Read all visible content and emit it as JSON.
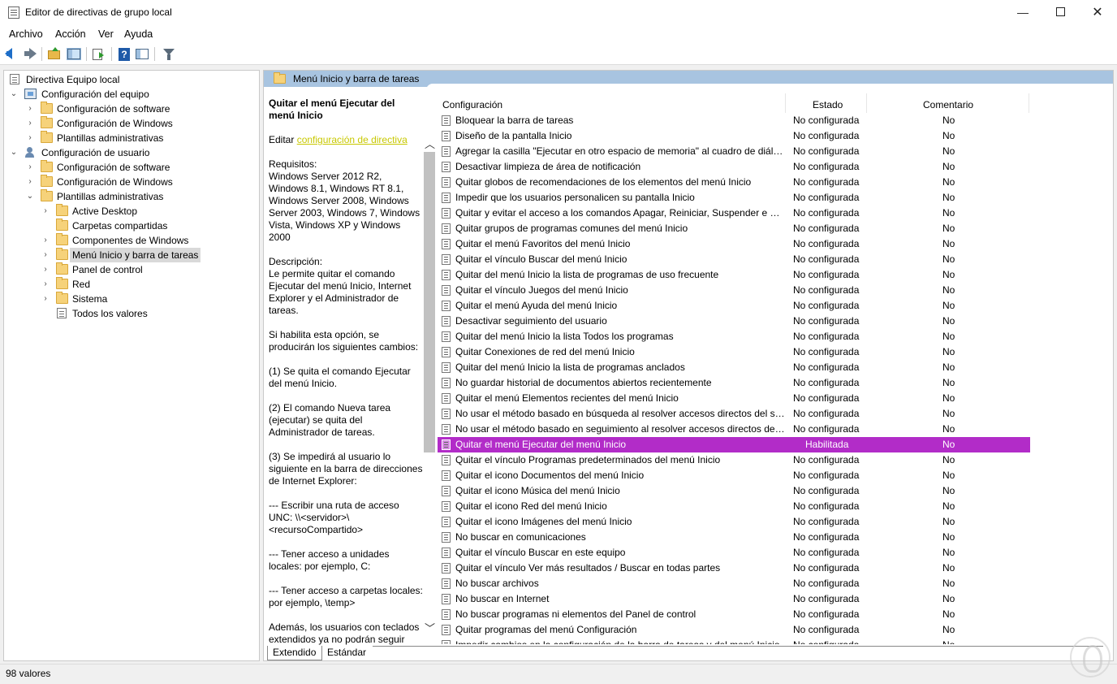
{
  "window": {
    "title": "Editor de directivas de grupo local",
    "min_glyph": "—",
    "close_glyph": "✕"
  },
  "menu": [
    "Archivo",
    "Acción",
    "Ver",
    "Ayuda"
  ],
  "toolbar": {
    "icons": [
      "back-arrow-icon",
      "forward-arrow-icon",
      "up-folder-icon",
      "show-hide-tree-icon",
      "export-list-icon",
      "help-icon",
      "properties-panel-icon",
      "filter-icon"
    ]
  },
  "tree": {
    "root": "Directiva Equipo local",
    "computer": "Configuración del equipo",
    "computer_children": [
      "Configuración de software",
      "Configuración de Windows",
      "Plantillas administrativas"
    ],
    "user": "Configuración de usuario",
    "user_children": [
      "Configuración de software",
      "Configuración de Windows",
      "Plantillas administrativas"
    ],
    "admin_children": [
      "Active Desktop",
      "Carpetas compartidas",
      "Componentes de Windows",
      "Menú Inicio y barra de tareas",
      "Panel de control",
      "Red",
      "Sistema",
      "Todos los valores"
    ],
    "selected": "Menú Inicio y barra de tareas"
  },
  "pane": {
    "header": "Menú Inicio y barra de tareas"
  },
  "description": {
    "title": "Quitar el menú Ejecutar del menú Inicio",
    "edit_prefix": "Editar ",
    "edit_link": "configuración de directiva",
    "requirements": "Requisitos:\nWindows Server 2012 R2, Windows 8.1, Windows RT 8.1, Windows Server 2008, Windows Server 2003, Windows 7, Windows Vista, Windows XP y Windows 2000",
    "description": "Descripción:\nLe permite quitar el comando Ejecutar del menú Inicio, Internet Explorer y el Administrador de tareas.",
    "p1": "Si habilita esta opción, se producirán los siguientes cambios:",
    "p2": "(1) Se quita el comando Ejecutar del menú Inicio.",
    "p3": "(2) El comando Nueva tarea (ejecutar) se quita del Administrador de tareas.",
    "p4": "(3) Se impedirá al usuario lo siguiente en la barra de direcciones de Internet Explorer:",
    "p5": "--- Escribir una ruta de acceso UNC: \\\\<servidor>\\<recursoCompartido>",
    "p6": "--- Tener acceso a unidades locales: por ejemplo, C:",
    "p7": "--- Tener acceso a carpetas locales: por ejemplo, \\temp>",
    "p8": "Además, los usuarios con teclados extendidos ya no podrán seguir"
  },
  "columns": {
    "setting": "Configuración",
    "state": "Estado",
    "comment": "Comentario"
  },
  "rows": [
    {
      "name": "Bloquear la barra de tareas",
      "state": "No configurada",
      "comment": "No"
    },
    {
      "name": "Diseño de la pantalla Inicio",
      "state": "No configurada",
      "comment": "No"
    },
    {
      "name": "Agregar la casilla \"Ejecutar en otro espacio de memoria\" al cuadro de diálo...",
      "state": "No configurada",
      "comment": "No"
    },
    {
      "name": "Desactivar limpieza de área de notificación",
      "state": "No configurada",
      "comment": "No"
    },
    {
      "name": "Quitar globos de recomendaciones de los elementos del menú Inicio",
      "state": "No configurada",
      "comment": "No"
    },
    {
      "name": "Impedir que los usuarios personalicen su pantalla Inicio",
      "state": "No configurada",
      "comment": "No"
    },
    {
      "name": "Quitar y evitar el acceso a los comandos Apagar, Reiniciar, Suspender e Hib...",
      "state": "No configurada",
      "comment": "No"
    },
    {
      "name": "Quitar grupos de programas comunes del menú Inicio",
      "state": "No configurada",
      "comment": "No"
    },
    {
      "name": "Quitar el menú Favoritos del menú Inicio",
      "state": "No configurada",
      "comment": "No"
    },
    {
      "name": "Quitar el vínculo Buscar del menú Inicio",
      "state": "No configurada",
      "comment": "No"
    },
    {
      "name": "Quitar del menú Inicio la lista de programas de uso frecuente",
      "state": "No configurada",
      "comment": "No"
    },
    {
      "name": "Quitar el vínculo Juegos del menú Inicio",
      "state": "No configurada",
      "comment": "No"
    },
    {
      "name": "Quitar el menú Ayuda del menú Inicio",
      "state": "No configurada",
      "comment": "No"
    },
    {
      "name": "Desactivar seguimiento del usuario",
      "state": "No configurada",
      "comment": "No"
    },
    {
      "name": "Quitar del menú Inicio la lista Todos los programas",
      "state": "No configurada",
      "comment": "No"
    },
    {
      "name": "Quitar Conexiones de red del menú Inicio",
      "state": "No configurada",
      "comment": "No"
    },
    {
      "name": "Quitar del menú Inicio la lista de programas anclados",
      "state": "No configurada",
      "comment": "No"
    },
    {
      "name": "No guardar historial de documentos abiertos recientemente",
      "state": "No configurada",
      "comment": "No"
    },
    {
      "name": "Quitar el menú Elementos recientes del menú Inicio",
      "state": "No configurada",
      "comment": "No"
    },
    {
      "name": "No usar el método basado en búsqueda al resolver accesos directos del shell",
      "state": "No configurada",
      "comment": "No"
    },
    {
      "name": "No usar el método basado en seguimiento al resolver accesos directos del s...",
      "state": "No configurada",
      "comment": "No"
    },
    {
      "name": "Quitar el menú Ejecutar del menú Inicio",
      "state": "Habilitada",
      "comment": "No",
      "highlight": true
    },
    {
      "name": "Quitar el vínculo Programas predeterminados del menú Inicio",
      "state": "No configurada",
      "comment": "No"
    },
    {
      "name": "Quitar el icono Documentos del menú Inicio",
      "state": "No configurada",
      "comment": "No"
    },
    {
      "name": "Quitar el icono Música del menú Inicio",
      "state": "No configurada",
      "comment": "No"
    },
    {
      "name": "Quitar el icono Red del menú Inicio",
      "state": "No configurada",
      "comment": "No"
    },
    {
      "name": "Quitar el icono Imágenes del menú Inicio",
      "state": "No configurada",
      "comment": "No"
    },
    {
      "name": "No buscar en comunicaciones",
      "state": "No configurada",
      "comment": "No"
    },
    {
      "name": "Quitar el vínculo Buscar en este equipo",
      "state": "No configurada",
      "comment": "No"
    },
    {
      "name": "Quitar el vínculo Ver más resultados / Buscar en todas partes",
      "state": "No configurada",
      "comment": "No"
    },
    {
      "name": "No buscar archivos",
      "state": "No configurada",
      "comment": "No"
    },
    {
      "name": "No buscar en Internet",
      "state": "No configurada",
      "comment": "No"
    },
    {
      "name": "No buscar programas ni elementos del Panel de control",
      "state": "No configurada",
      "comment": "No"
    },
    {
      "name": "Quitar programas del menú Configuración",
      "state": "No configurada",
      "comment": "No"
    },
    {
      "name": "Impedir cambios en la configuración de la barra de tareas y del menú Inicio",
      "state": "No configurada",
      "comment": "No",
      "cut": true
    }
  ],
  "tabs": {
    "extended": "Extendido",
    "standard": "Estándar"
  },
  "status": {
    "count": "98 valores"
  }
}
